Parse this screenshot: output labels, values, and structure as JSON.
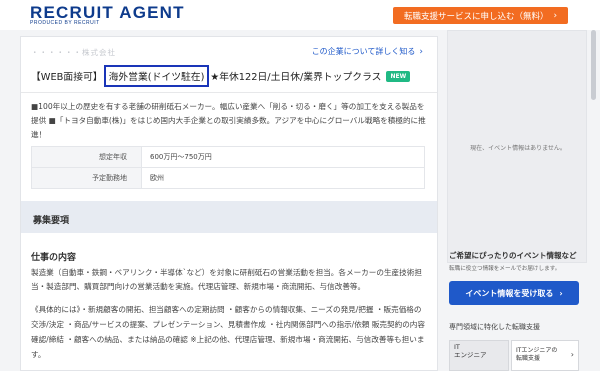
{
  "header": {
    "logo_text": "RECRUIT AGENT",
    "logo_sub": "PRODUCED BY RECRUIT",
    "cta_label": "転職支援サービスに申し込む（無料）",
    "cta_color": "#f26c21",
    "cta_icon": "chevron-right-icon"
  },
  "job": {
    "company_masked": "・・・・・・株式会社",
    "about_link": "この企業について詳しく知る",
    "title_prefix": "【WEB面接可】",
    "title_highlight": "海外営業(ドイツ駐在)",
    "title_suffix": "★年休122日/土日休/業界トップクラス",
    "new_badge": "NEW",
    "description": "■100年以上の歴史を有する老舗の研削砥石メーカー。幅広い産業へ「削る・切る・磨く」等の加工を支える製品を提供 ■「トヨタ自動車(株)」をはじめ国内大手企業との取引実績多数。アジアを中心にグローバル戦略を積極的に推進！",
    "table": [
      {
        "label": "想定年収",
        "value": "600万円〜750万円"
      },
      {
        "label": "予定勤務地",
        "value": "欧州"
      }
    ]
  },
  "section": {
    "title": "募集要項",
    "sub_title": "仕事の内容",
    "body1": "製造業（自動車・鉄鋼・ベアリンク・半導体`など）を対象に研削砥石の営業活動を担当。各メーカーの生産技術担当・製造部門、購買部門向けの営業活動を実施。代理店管理、新規市場・商流開拓、与信改善等。",
    "body2": "《具体的には》・新規顧客の開拓、担当顧客への定期訪問 ・顧客からの情報収集、ニーズの発見/把握 ・販売価格の交渉/決定 ・商品/サービスの提案、プレゼンテーション、見積書作成 ・社内関係部門への指示/依頼 販売契約の内容確認/締結 ・顧客への納品、または納品の確認 ※上記の他、代理店管理、新規市場・商流開拓、与信改善等も担います。"
  },
  "sidebar": {
    "event_placeholder": "現在、イベント情報はありません。",
    "event_note_title": "ご希望にぴったりのイベント情報など",
    "event_note_sub": "転職に役立つ情報をメールでお届けします。",
    "event_button": "イベント情報を受け取る",
    "event_button_color": "#1f59c9",
    "spec_title": "専門領域に特化した転職支援",
    "spec_card1_line1": "IT",
    "spec_card1_line2": "エンジニア",
    "spec_card2_line1": "ITエンジニアの",
    "spec_card2_line2": "転職支援"
  }
}
